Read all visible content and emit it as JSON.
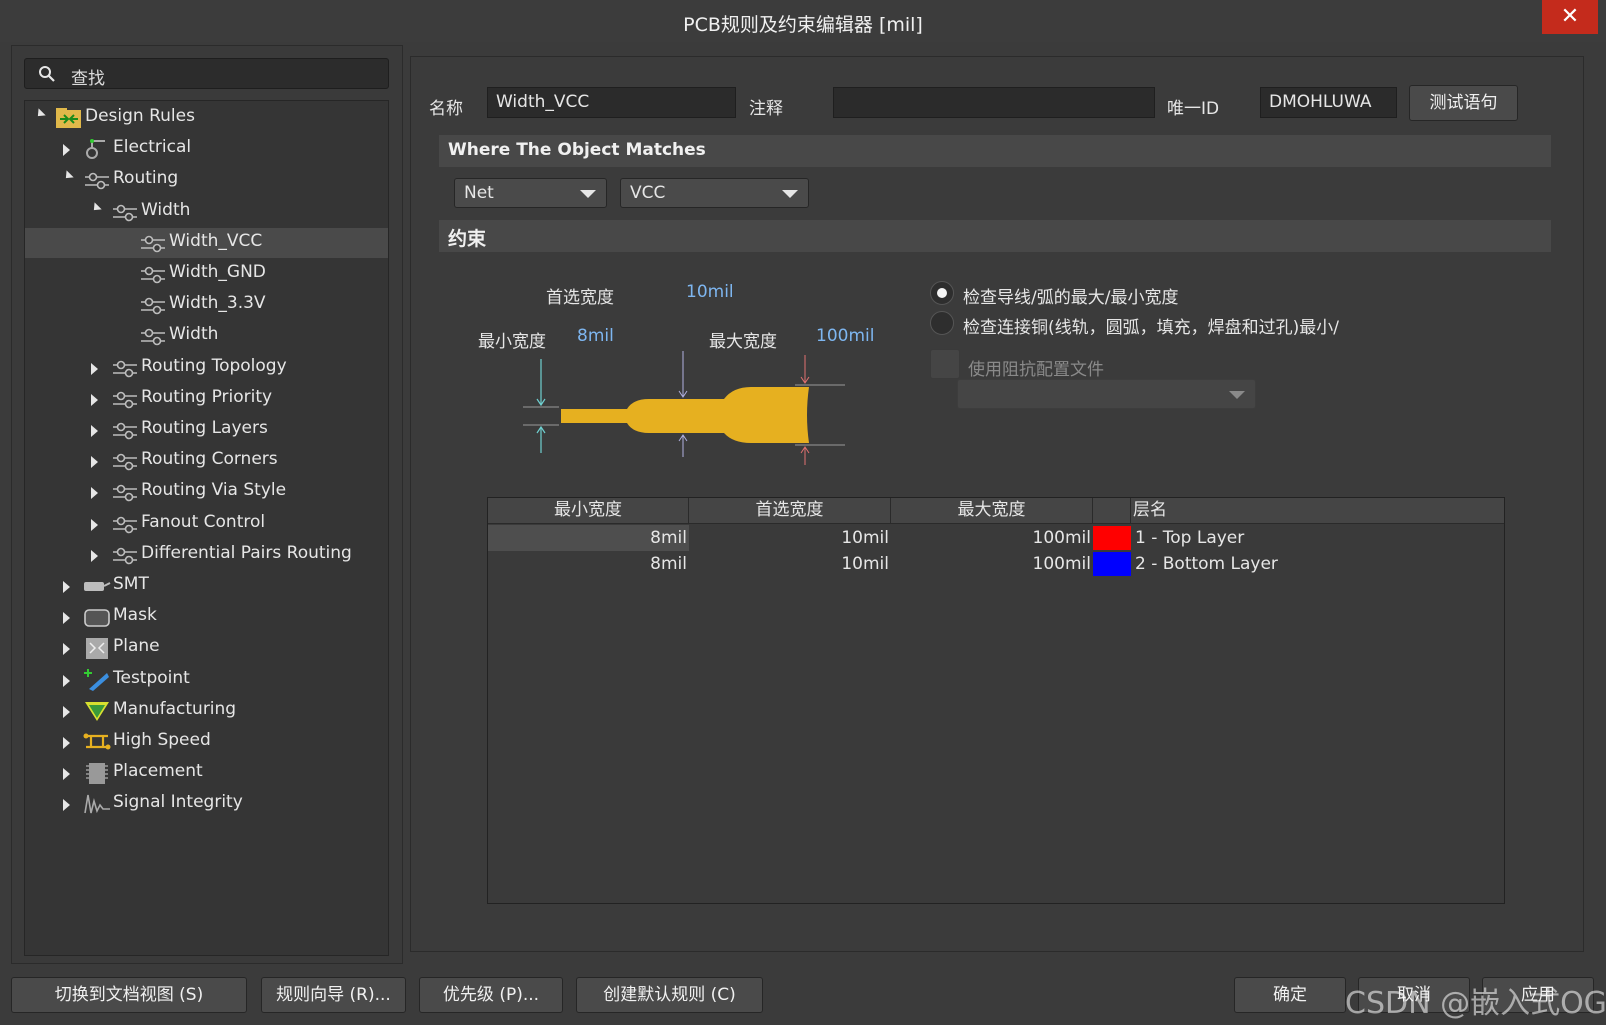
{
  "window": {
    "title": "PCB规则及约束编辑器 [mil]",
    "close_glyph": "✕"
  },
  "search": {
    "placeholder": "查找"
  },
  "tree": [
    {
      "label": "Design Rules",
      "icon": "design-rules-icon"
    },
    {
      "label": "Electrical",
      "icon": "electrical-icon"
    },
    {
      "label": "Routing",
      "icon": "routing-icon"
    },
    {
      "label": "Width",
      "icon": "routing-icon"
    },
    {
      "label": "Width_VCC",
      "icon": "routing-icon"
    },
    {
      "label": "Width_GND",
      "icon": "routing-icon"
    },
    {
      "label": "Width_3.3V",
      "icon": "routing-icon"
    },
    {
      "label": "Width",
      "icon": "routing-icon"
    },
    {
      "label": "Routing Topology",
      "icon": "routing-icon"
    },
    {
      "label": "Routing Priority",
      "icon": "routing-icon"
    },
    {
      "label": "Routing Layers",
      "icon": "routing-icon"
    },
    {
      "label": "Routing Corners",
      "icon": "routing-icon"
    },
    {
      "label": "Routing Via Style",
      "icon": "routing-icon"
    },
    {
      "label": "Fanout Control",
      "icon": "routing-icon"
    },
    {
      "label": "Differential Pairs Routing",
      "icon": "routing-icon"
    },
    {
      "label": "SMT",
      "icon": "smt-icon"
    },
    {
      "label": "Mask",
      "icon": "mask-icon"
    },
    {
      "label": "Plane",
      "icon": "plane-icon"
    },
    {
      "label": "Testpoint",
      "icon": "testpoint-icon"
    },
    {
      "label": "Manufacturing",
      "icon": "manufacturing-icon"
    },
    {
      "label": "High Speed",
      "icon": "high-speed-icon"
    },
    {
      "label": "Placement",
      "icon": "placement-icon"
    },
    {
      "label": "Signal Integrity",
      "icon": "signal-integrity-icon"
    }
  ],
  "rule": {
    "name_label": "名称",
    "name_value": "Width_VCC",
    "comment_label": "注释",
    "comment_value": "",
    "uid_label": "唯一ID",
    "uid_value": "DMOHLUWA",
    "test_button": "测试语句"
  },
  "match": {
    "header": "Where The Object Matches",
    "type_value": "Net",
    "net_value": "VCC"
  },
  "constraints": {
    "header": "约束",
    "preferred_label": "首选宽度",
    "preferred_value": "10mil",
    "min_label": "最小宽度",
    "min_value": "8mil",
    "max_label": "最大宽度",
    "max_value": "100mil",
    "radio1_label": "检查导线/弧的最大/最小宽度",
    "radio2_label": "检查连接铜(线轨，圆弧，填充，焊盘和过孔)最小/",
    "impedance_label": "使用阻抗配置文件",
    "impedance_value": ""
  },
  "grid": {
    "headers": [
      "最小宽度",
      "首选宽度",
      "最大宽度",
      "层名"
    ],
    "rows": [
      {
        "min": "8mil",
        "pref": "10mil",
        "max": "100mil",
        "color": "#ff0000",
        "layer": "1 - Top Layer"
      },
      {
        "min": "8mil",
        "pref": "10mil",
        "max": "100mil",
        "color": "#0000ff",
        "layer": "2 - Bottom Layer"
      }
    ]
  },
  "footer": {
    "doc_view": "切换到文档视图 (S)",
    "wizard": "规则向导 (R)...",
    "priority": "优先级 (P)...",
    "create_default": "创建默认规则 (C)",
    "ok": "确定",
    "cancel": "取消",
    "apply": "应用",
    "watermark": "CSDN @嵌入式OG"
  },
  "colors": {
    "trace_color": "#e6b020",
    "accent_text": "#7eb6f0"
  }
}
